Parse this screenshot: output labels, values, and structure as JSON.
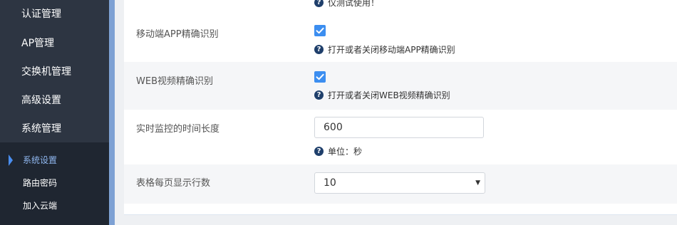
{
  "sidebar": {
    "menu": [
      {
        "label": "认证管理"
      },
      {
        "label": "AP管理"
      },
      {
        "label": "交换机管理"
      },
      {
        "label": "高级设置"
      },
      {
        "label": "系统管理"
      }
    ],
    "submenu": [
      {
        "label": "系统设置",
        "active": true
      },
      {
        "label": "路由密码"
      },
      {
        "label": "加入云端"
      }
    ]
  },
  "settings": {
    "top_hint": "仅测试使用！",
    "mobile_app": {
      "label": "移动端APP精确识别",
      "checked": true,
      "hint": "打开或者关闭移动端APP精确识别"
    },
    "web_video": {
      "label": "WEB视频精确识别",
      "checked": true,
      "hint": "打开或者关闭WEB视频精确识别"
    },
    "monitor_time": {
      "label": "实时监控的时间长度",
      "value": "600",
      "hint": "单位：秒"
    },
    "rows_per_page": {
      "label": "表格每页显示行数",
      "value": "10"
    }
  },
  "icons": {
    "help": "question-circle-icon",
    "check": "checkmark-icon",
    "active_marker": "caret-right-icon",
    "dropdown": "triangle-down-icon"
  },
  "colors": {
    "sidebar_bg": "#2d3542",
    "submenu_bg": "#1f2631",
    "accent": "#3c8ef0",
    "help_icon": "#1f3f6b"
  }
}
